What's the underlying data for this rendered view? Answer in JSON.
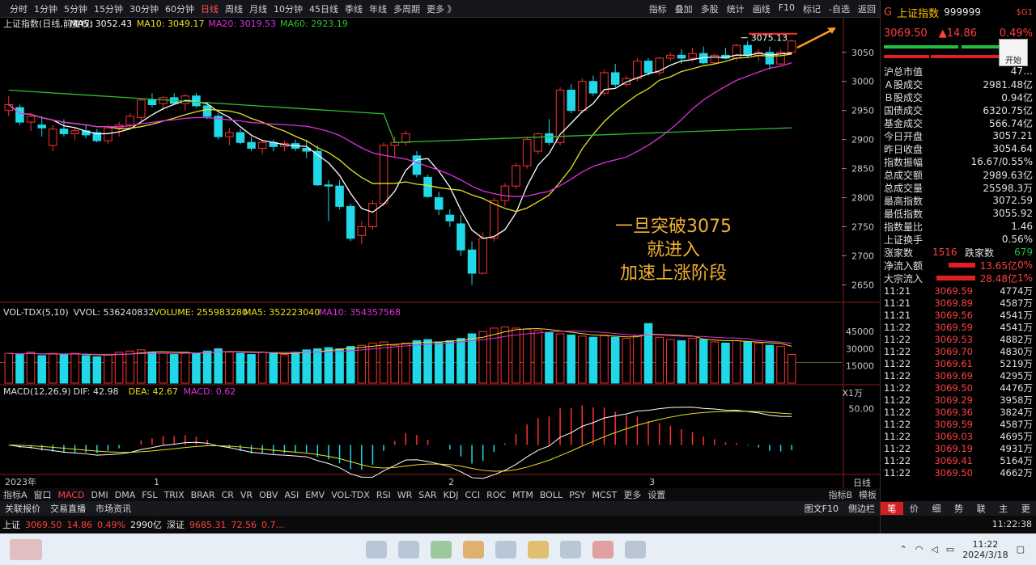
{
  "topbar": {
    "left_tabs": [
      "分时",
      "1分钟",
      "5分钟",
      "15分钟",
      "30分钟",
      "60分钟",
      "日线",
      "周线",
      "月线",
      "10分钟",
      "45日线",
      "季线",
      "年线",
      "多周期",
      "更多 》"
    ],
    "active_tab": "日线",
    "right_tabs": [
      "指标",
      "叠加",
      "多股",
      "统计",
      "画线",
      "F10",
      "标记",
      "-自选",
      "返回"
    ]
  },
  "chart_header": {
    "name": "上证指数(日线,前复权)",
    "ma5": "MA5: 3052.43",
    "ma10": "MA10: 3049.17",
    "ma20": "MA20: 3019.53",
    "ma60": "MA60: 2923.19"
  },
  "vol_header": {
    "name": "VOL-TDX(5,10)",
    "vvol": "VVOL: 536240832",
    "volume": "VOLUME: 255983280",
    "ma5": "MA5: 352223040",
    "ma10": "MA10: 354357568"
  },
  "macd_header": {
    "name": "MACD(12,26,9)",
    "dif": "DIF: 42.98",
    "dea": "DEA: 42.67",
    "macd": "MACD: 0.62"
  },
  "axis": {
    "price_ticks": [
      "3050",
      "3000",
      "2950",
      "2900",
      "2850",
      "2800",
      "2750",
      "2700",
      "2650"
    ],
    "vol_ticks": [
      "45000",
      "30000",
      "15000"
    ],
    "vol_unit": "X1万",
    "macd_ticks": [
      "50.00"
    ],
    "x_labels": [
      "2023年",
      "1",
      "2",
      "3"
    ],
    "period_label": "日线",
    "high_label": "3075.13"
  },
  "annotation": [
    "一旦突破3075",
    "就进入",
    "加速上涨阶段"
  ],
  "indicator_tabs": {
    "items": [
      "指标A",
      "窗口",
      "MACD",
      "DMI",
      "DMA",
      "FSL",
      "TRIX",
      "BRAR",
      "CR",
      "VR",
      "OBV",
      "ASI",
      "EMV",
      "VOL-TDX",
      "RSI",
      "WR",
      "SAR",
      "KDJ",
      "CCI",
      "ROC",
      "MTM",
      "BOLL",
      "PSY",
      "MCST",
      "更多",
      "设置"
    ],
    "active": "MACD",
    "right": [
      "指标B",
      "模板"
    ]
  },
  "subtabs": {
    "items": [
      "关联报价",
      "交易直播",
      "市场资讯"
    ],
    "right": [
      "图文F10",
      "侧边栏"
    ]
  },
  "ticker": {
    "items": [
      {
        "t": "上证",
        "c": "white"
      },
      {
        "t": "3069.50",
        "c": "red"
      },
      {
        "t": "14.86",
        "c": "red"
      },
      {
        "t": "0.49%",
        "c": "red"
      },
      {
        "t": "2990亿",
        "c": "white"
      },
      {
        "t": "深证",
        "c": "white"
      },
      {
        "t": "9685.31",
        "c": "red"
      },
      {
        "t": "72.56",
        "c": "red"
      },
      {
        "t": "0.7…",
        "c": "red"
      }
    ]
  },
  "quote": {
    "code_prefix": "G",
    "name": "上证指数",
    "code": "999999",
    "badge": "$G1",
    "price": "3069.50",
    "change": "▲14.86",
    "change_pct": "0.49%",
    "open_btn": "开始"
  },
  "stats": [
    {
      "k": "沪总市值",
      "v": "47…",
      "c": "white"
    },
    {
      "k": "Ａ股成交",
      "v": "2981.48亿",
      "c": "white"
    },
    {
      "k": "Ｂ股成交",
      "v": "0.94亿",
      "c": "white"
    },
    {
      "k": "国债成交",
      "v": "6320.75亿",
      "c": "white"
    },
    {
      "k": "基金成交",
      "v": "566.74亿",
      "c": "white"
    },
    {
      "k": "今日开盘",
      "v": "3057.21",
      "c": "red"
    },
    {
      "k": "昨日收盘",
      "v": "3054.64",
      "c": "white"
    },
    {
      "k": "指数振幅",
      "v": "16.67/0.55%",
      "c": "white"
    },
    {
      "k": "总成交额",
      "v": "2989.63亿",
      "c": "white"
    },
    {
      "k": "总成交量",
      "v": "25598.3万",
      "c": "white"
    },
    {
      "k": "最高指数",
      "v": "3072.59",
      "c": "red"
    },
    {
      "k": "最低指数",
      "v": "3055.92",
      "c": "red"
    },
    {
      "k": "指数量比",
      "v": "1.46",
      "c": "red"
    },
    {
      "k": "上证换手",
      "v": "0.56%",
      "c": "white"
    }
  ],
  "breadth": {
    "up_label": "涨家数",
    "up": "1516",
    "down_label": "跌家数",
    "down": "679"
  },
  "flows": [
    {
      "k": "净流入额",
      "v": "13.65亿",
      "p": "0%",
      "frac": 0.55
    },
    {
      "k": "大宗流入",
      "v": "28.48亿",
      "p": "1%",
      "frac": 0.8
    }
  ],
  "trades": [
    {
      "t": "11:21",
      "p": "3069.59",
      "v": "4774万"
    },
    {
      "t": "11:21",
      "p": "3069.89",
      "v": "4587万"
    },
    {
      "t": "11:21",
      "p": "3069.56",
      "v": "4541万"
    },
    {
      "t": "11:22",
      "p": "3069.59",
      "v": "4541万"
    },
    {
      "t": "11:22",
      "p": "3069.53",
      "v": "4882万"
    },
    {
      "t": "11:22",
      "p": "3069.70",
      "v": "4830万"
    },
    {
      "t": "11:22",
      "p": "3069.61",
      "v": "5219万"
    },
    {
      "t": "11:22",
      "p": "3069.69",
      "v": "4295万"
    },
    {
      "t": "11:22",
      "p": "3069.50",
      "v": "4476万"
    },
    {
      "t": "11:22",
      "p": "3069.29",
      "v": "3958万"
    },
    {
      "t": "11:22",
      "p": "3069.36",
      "v": "3824万"
    },
    {
      "t": "11:22",
      "p": "3069.59",
      "v": "4587万"
    },
    {
      "t": "11:22",
      "p": "3069.03",
      "v": "4695万"
    },
    {
      "t": "11:22",
      "p": "3069.19",
      "v": "4931万"
    },
    {
      "t": "11:22",
      "p": "3069.41",
      "v": "5164万"
    },
    {
      "t": "11:22",
      "p": "3069.50",
      "v": "4662万"
    }
  ],
  "rp_tabs": {
    "items": [
      "笔",
      "价",
      "细",
      "势",
      "联",
      "主",
      "更"
    ],
    "active": "笔"
  },
  "rp_ticker_time": "11:22:38",
  "clock": {
    "time": "11:22",
    "date": "2024/3/18"
  },
  "colors": {
    "up": "#ff3030",
    "down": "#20d8e8",
    "ma5": "#ffffff",
    "ma10": "#e8e020",
    "ma20": "#e030e0",
    "ma60": "#30c030",
    "grid": "#8b1a1a"
  },
  "chart_data": {
    "type": "candlestick",
    "title": "上证指数(日线,前复权)",
    "ylim": [
      2620,
      3090
    ],
    "candles": [
      [
        2950,
        2975,
        2940,
        2960
      ],
      [
        2955,
        2960,
        2925,
        2930
      ],
      [
        2930,
        2945,
        2915,
        2940
      ],
      [
        2925,
        2940,
        2905,
        2920
      ],
      [
        2890,
        2925,
        2880,
        2918
      ],
      [
        2918,
        2935,
        2905,
        2910
      ],
      [
        2910,
        2920,
        2900,
        2915
      ],
      [
        2915,
        2925,
        2902,
        2908
      ],
      [
        2912,
        2918,
        2895,
        2898
      ],
      [
        2898,
        2925,
        2892,
        2920
      ],
      [
        2920,
        2930,
        2905,
        2925
      ],
      [
        2925,
        2945,
        2918,
        2940
      ],
      [
        2938,
        2970,
        2930,
        2968
      ],
      [
        2968,
        2980,
        2955,
        2960
      ],
      [
        2962,
        2975,
        2950,
        2972
      ],
      [
        2972,
        2980,
        2960,
        2962
      ],
      [
        2962,
        2978,
        2950,
        2975
      ],
      [
        2975,
        2980,
        2955,
        2958
      ],
      [
        2958,
        2965,
        2935,
        2940
      ],
      [
        2940,
        2945,
        2900,
        2905
      ],
      [
        2905,
        2920,
        2890,
        2912
      ],
      [
        2912,
        2918,
        2892,
        2895
      ],
      [
        2895,
        2905,
        2880,
        2885
      ],
      [
        2885,
        2900,
        2875,
        2895
      ],
      [
        2895,
        2900,
        2880,
        2888
      ],
      [
        2888,
        2898,
        2880,
        2893
      ],
      [
        2893,
        2900,
        2880,
        2885
      ],
      [
        2885,
        2900,
        2868,
        2880
      ],
      [
        2880,
        2890,
        2820,
        2822
      ],
      [
        2822,
        2830,
        2760,
        2820
      ],
      [
        2820,
        2830,
        2780,
        2785
      ],
      [
        2785,
        2790,
        2725,
        2730
      ],
      [
        2735,
        2760,
        2720,
        2750
      ],
      [
        2750,
        2795,
        2745,
        2790
      ],
      [
        2790,
        2895,
        2785,
        2890
      ],
      [
        2890,
        2905,
        2870,
        2895
      ],
      [
        2895,
        2915,
        2890,
        2910
      ],
      [
        2872,
        2880,
        2835,
        2840
      ],
      [
        2835,
        2840,
        2800,
        2802
      ],
      [
        2800,
        2810,
        2770,
        2780
      ],
      [
        2770,
        2780,
        2750,
        2760
      ],
      [
        2755,
        2770,
        2700,
        2710
      ],
      [
        2710,
        2725,
        2650,
        2670
      ],
      [
        2670,
        2740,
        2668,
        2730
      ],
      [
        2730,
        2800,
        2725,
        2795
      ],
      [
        2795,
        2825,
        2785,
        2820
      ],
      [
        2820,
        2860,
        2815,
        2855
      ],
      [
        2855,
        2905,
        2850,
        2900
      ],
      [
        2880,
        2912,
        2875,
        2910
      ],
      [
        2910,
        2935,
        2890,
        2895
      ],
      [
        2895,
        2990,
        2890,
        2985
      ],
      [
        2985,
        2995,
        2945,
        2950
      ],
      [
        2950,
        3005,
        2945,
        3000
      ],
      [
        3000,
        3010,
        2975,
        2980
      ],
      [
        2980,
        3020,
        2975,
        3015
      ],
      [
        3015,
        3030,
        2990,
        2995
      ],
      [
        2995,
        3010,
        2990,
        3005
      ],
      [
        3005,
        3040,
        3000,
        3035
      ],
      [
        3035,
        3040,
        3010,
        3015
      ],
      [
        3015,
        3042,
        3010,
        3040
      ],
      [
        3040,
        3050,
        3035,
        3045
      ],
      [
        3045,
        3055,
        3030,
        3040
      ],
      [
        3040,
        3058,
        3035,
        3048
      ],
      [
        3048,
        3060,
        3030,
        3032
      ],
      [
        3032,
        3048,
        3030,
        3045
      ],
      [
        3045,
        3058,
        3038,
        3040
      ],
      [
        3040,
        3065,
        3035,
        3062
      ],
      [
        3062,
        3070,
        3040,
        3045
      ],
      [
        3045,
        3055,
        3035,
        3050
      ],
      [
        3050,
        3060,
        3020,
        3030
      ],
      [
        3030,
        3055,
        3028,
        3050
      ],
      [
        3050,
        3072,
        3048,
        3069.5
      ]
    ]
  }
}
